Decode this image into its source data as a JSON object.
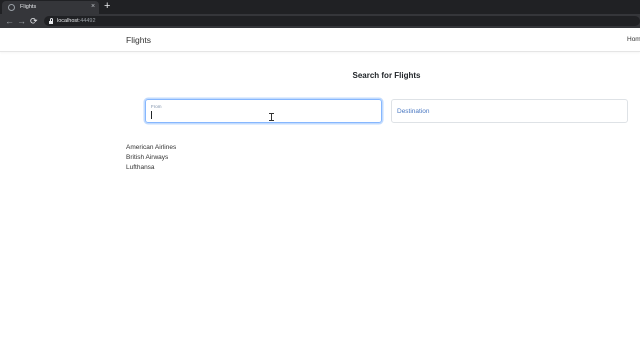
{
  "browser": {
    "tab_title": "Flights",
    "tab_close": "×",
    "new_tab": "+",
    "nav": {
      "back": "←",
      "forward": "→",
      "reload": "⟳"
    },
    "url_host": "localhost",
    "url_port": ":44492"
  },
  "navbar": {
    "brand": "Flights",
    "home_link": "Hom"
  },
  "search": {
    "heading": "Search for Flights",
    "from_label": "From",
    "destination_placeholder": "Destination"
  },
  "airlines": [
    "American Airlines",
    "British Airways",
    "Lufthansa"
  ]
}
